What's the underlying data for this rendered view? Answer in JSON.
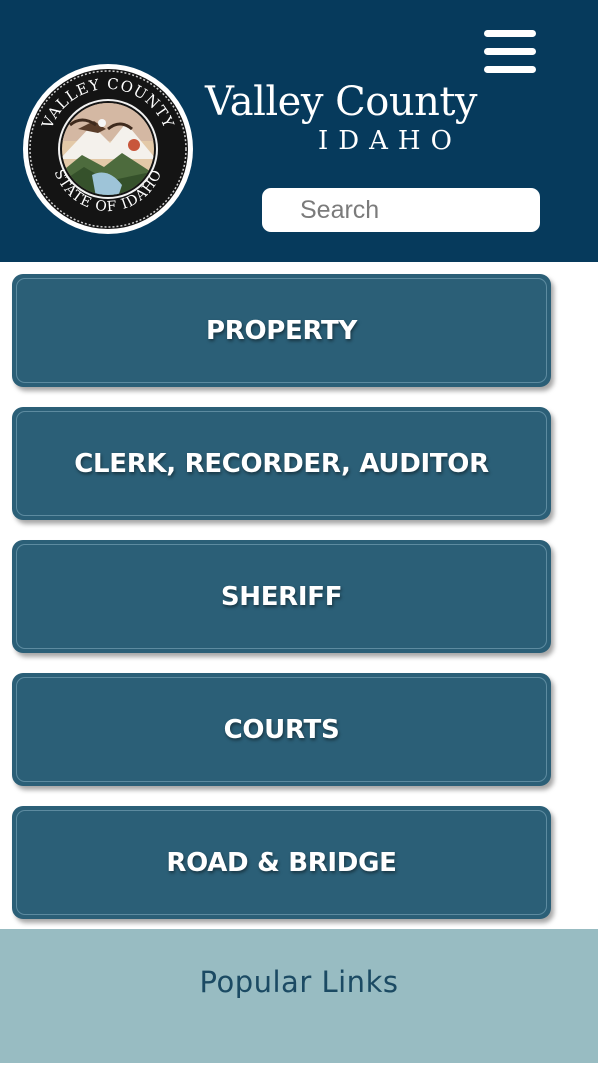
{
  "header": {
    "title": "Valley County",
    "subtitle": "IDAHO",
    "seal": {
      "icon": "county-seal",
      "top_text": "VALLEY COUNTY",
      "bottom_text": "STATE OF IDAHO"
    },
    "menu_icon": "hamburger-menu-icon",
    "search": {
      "placeholder": "Search",
      "value": ""
    },
    "background_color": "#063a5c"
  },
  "nav": {
    "tile_color": "#2b5f77",
    "items": [
      {
        "label": "PROPERTY"
      },
      {
        "label": "CLERK, RECORDER, AUDITOR"
      },
      {
        "label": "SHERIFF"
      },
      {
        "label": "COURTS"
      },
      {
        "label": "ROAD & BRIDGE"
      }
    ]
  },
  "footer": {
    "popular_links_label": "Popular Links",
    "background_color": "#98bcc2"
  }
}
